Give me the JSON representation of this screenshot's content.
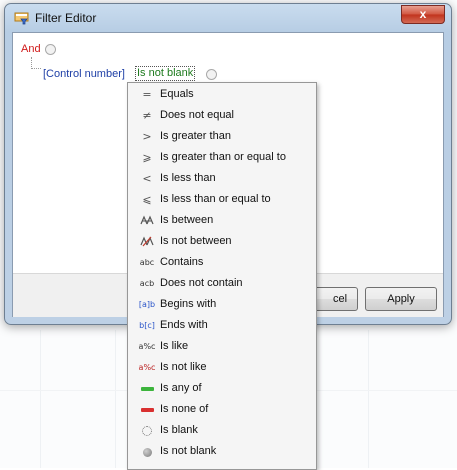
{
  "window": {
    "title": "Filter Editor",
    "close_glyph": "x"
  },
  "editor": {
    "group_operator": "And",
    "condition": {
      "field": "[Control number]",
      "operator": "Is not blank"
    }
  },
  "buttons": {
    "cancel_partial": "cel",
    "apply": "Apply"
  },
  "operator_menu": {
    "items": [
      {
        "label": "Equals",
        "icon": "equals-icon",
        "glyph": "="
      },
      {
        "label": "Does not equal",
        "icon": "not-equal-icon",
        "glyph": "≠"
      },
      {
        "label": "Is greater than",
        "icon": "greater-than-icon",
        "glyph": ">"
      },
      {
        "label": "Is greater than or equal to",
        "icon": "greater-or-equal-icon",
        "glyph": "⩾"
      },
      {
        "label": "Is less than",
        "icon": "less-than-icon",
        "glyph": "<"
      },
      {
        "label": "Is less than or equal to",
        "icon": "less-or-equal-icon",
        "glyph": "⩽"
      },
      {
        "label": "Is between",
        "icon": "between-icon",
        "glyph": ""
      },
      {
        "label": "Is not between",
        "icon": "not-between-icon",
        "glyph": ""
      },
      {
        "label": "Contains",
        "icon": "contains-icon",
        "glyph": "abc"
      },
      {
        "label": "Does not contain",
        "icon": "not-contain-icon",
        "glyph": "acb"
      },
      {
        "label": "Begins with",
        "icon": "begins-with-icon",
        "glyph": "[a]b"
      },
      {
        "label": "Ends with",
        "icon": "ends-with-icon",
        "glyph": "b[c]"
      },
      {
        "label": "Is like",
        "icon": "like-icon",
        "glyph": "a%c"
      },
      {
        "label": "Is not like",
        "icon": "not-like-icon",
        "glyph": "a%c"
      },
      {
        "label": "Is any of",
        "icon": "any-of-icon",
        "glyph": ""
      },
      {
        "label": "Is none of",
        "icon": "none-of-icon",
        "glyph": ""
      },
      {
        "label": "Is blank",
        "icon": "blank-icon",
        "glyph": ""
      },
      {
        "label": "Is not blank",
        "icon": "not-blank-icon",
        "glyph": ""
      }
    ]
  },
  "colors": {
    "group_operator": "#d01818",
    "field": "#1e3fa6",
    "operator": "#1d7a1d",
    "any_of_swatch": "#3cb43c",
    "none_of_swatch": "#d93030"
  }
}
